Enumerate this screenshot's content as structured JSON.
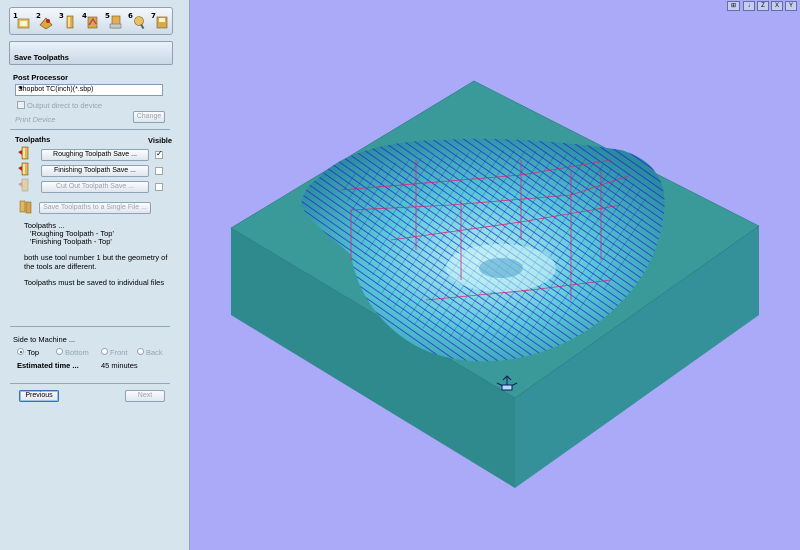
{
  "steps": [
    "1",
    "2",
    "3",
    "4",
    "5",
    "6",
    "7"
  ],
  "panel": {
    "title": "Save Toolpaths"
  },
  "post_processor": {
    "heading": "Post Processor",
    "selected": "Shopbot TC(inch)(*.sbp)",
    "output_direct_label": "Output direct to device",
    "output_direct_checked": false,
    "printer_label": "Print Device",
    "change_label": "Change"
  },
  "toolpaths": {
    "heading": "Toolpaths",
    "visible_heading": "Visible",
    "items": [
      {
        "label": "Roughing Toolpath Save ...",
        "visible": true,
        "enabled": true
      },
      {
        "label": "Finishing Toolpath Save ...",
        "visible": false,
        "enabled": true
      },
      {
        "label": "Cut Out Toolpath Save ...",
        "visible": false,
        "enabled": false
      }
    ],
    "single_file_label": "Save Toolpaths to a Single File ...",
    "note_lines": [
      "Toolpaths ...",
      "'Roughing Toolpath - Top'",
      "'Finishing Toolpath  - Top'",
      "both use  tool number 1 but the geometry of",
      "the tools are different.",
      "Toolpaths must be saved to individual files"
    ]
  },
  "side": {
    "heading": "Side to Machine ...",
    "options": [
      "Top",
      "Bottom",
      "Front",
      "Back"
    ],
    "selected": "Top",
    "estimated_label": "Estimated time ...",
    "estimated_value": "45 minutes"
  },
  "nav": {
    "previous": "Previous",
    "next": "Next"
  },
  "view_tools": [
    "⊞",
    "↓",
    "Z",
    "X",
    "Y"
  ],
  "colors": {
    "background": "#aaaaf8",
    "block_top": "#3a9a9a",
    "block_left": "#2f8a8e",
    "block_right": "#34919a",
    "pocket": "#5ac8d8",
    "toolpath_blue": "#1010d0",
    "toolpath_red": "#e0206a"
  }
}
